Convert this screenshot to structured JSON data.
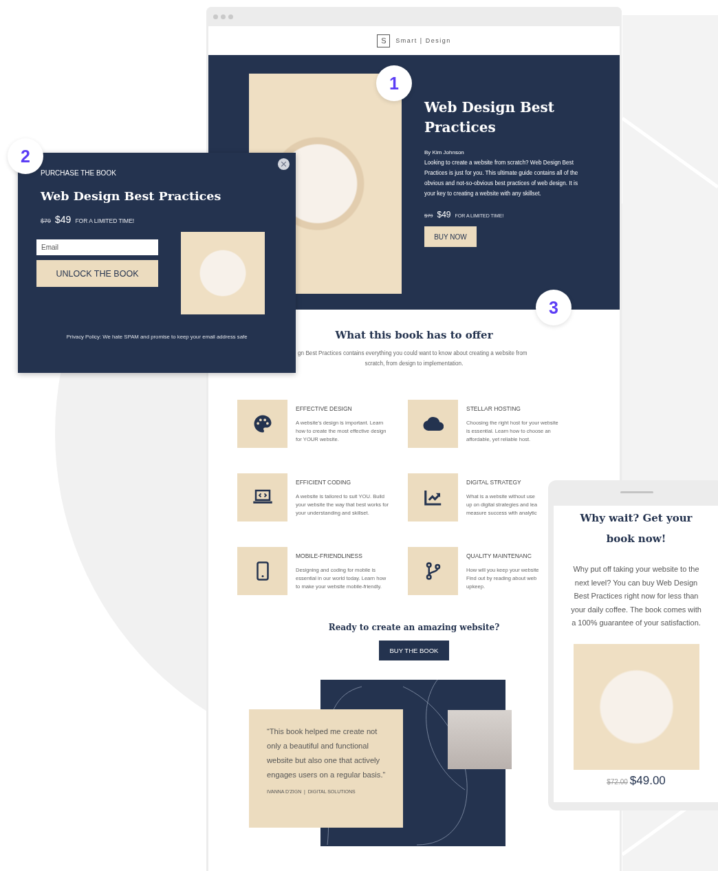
{
  "callouts": [
    "1",
    "2",
    "3"
  ],
  "browser": {
    "logo_letter": "S",
    "brand": "Smart | Design",
    "hero": {
      "title": "Web Design Best Practices",
      "author": "By  Kim Johnson",
      "description": "Looking to create a website from scratch? Web Design Best Practices is just for you. This ultimate guide contains all of the obvious and not-so-obvious best practices of web design. It is your key to creating a website with any skillset.",
      "old_price": "$79",
      "price": "$49",
      "price_note": "FOR A LIMITED TIME!",
      "button": "BUY NOW"
    },
    "offer": {
      "title": "What this book has to offer",
      "intro_lines": [
        "gn Best Practices contains everything you could want to know about creating a website from",
        "scratch, from design to implementation."
      ],
      "features": [
        {
          "kind": "palette",
          "title": "EFFECTIVE DESIGN",
          "lines": [
            "A website's design is important. Learn",
            "how to create the most effective design",
            "for YOUR website."
          ]
        },
        {
          "kind": "cloud",
          "title": "STELLAR HOSTING",
          "lines": [
            "Choosing the right host for your website",
            "is essential. Learn how to choose an",
            "affordable, yet reliable host."
          ]
        },
        {
          "kind": "laptop",
          "title": "EFFICIENT CODING",
          "lines": [
            "A website is tailored to suit YOU. Build",
            "your website the way that best works for",
            "your understanding and skillset."
          ]
        },
        {
          "kind": "chart",
          "title": "DIGITAL STRATEGY",
          "lines": [
            "What is a website without use",
            "up on digital strategies and lea",
            "measure success with analytic"
          ]
        },
        {
          "kind": "phone",
          "title": "MOBILE-FRIENDLINESS",
          "lines": [
            "Designing and coding for mobile is",
            "essential in our world today. Learn how",
            "to make your website mobile-friendly."
          ]
        },
        {
          "kind": "branch",
          "title": "QUALITY MAINTENANC",
          "lines": [
            "How will you keep your website",
            "Find out by reading about web",
            "upkeep."
          ]
        }
      ]
    },
    "cta": {
      "title": "Ready to create an amazing website?",
      "button": "BUY THE BOOK"
    },
    "testimonial": {
      "quote": "“This book helped me create not only a beautiful and functional website but also one that actively engages users on a regular basis.”",
      "author": "IVANNA D'ZIGN  |  DIGITAL SOLUTIONS"
    }
  },
  "popup": {
    "label": "PURCHASE THE BOOK",
    "title": "Web Design Best Practices",
    "old_price": "$79",
    "price": "$49",
    "price_note": "FOR A LIMITED TIME!",
    "email_placeholder": "Email",
    "button": "UNLOCK THE BOOK",
    "privacy": "Privacy Policy: We hate SPAM and promise to keep your email address safe"
  },
  "phone": {
    "title": "Why wait? Get your book now!",
    "text": "Why put off taking your website to the next level? You can buy Web Design Best Practices right now for less than your daily coffee. The book comes with a 100% guarantee of your satisfaction.",
    "old_price": "$72.00",
    "price": "$49.00"
  }
}
